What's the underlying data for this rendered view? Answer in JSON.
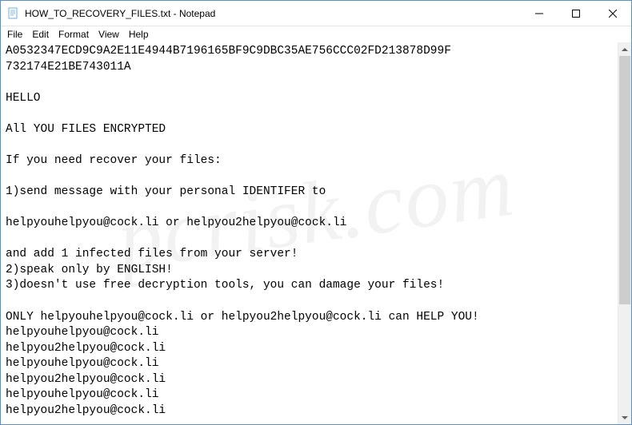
{
  "titlebar": {
    "title": "HOW_TO_RECOVERY_FILES.txt - Notepad"
  },
  "menubar": {
    "items": [
      "File",
      "Edit",
      "Format",
      "View",
      "Help"
    ]
  },
  "content": {
    "lines": [
      "A0532347ECD9C9A2E11E4944B7196165BF9C9DBC35AE756CCC02FD213878D99F",
      "732174E21BE743011A",
      "",
      "HELLO",
      "",
      "All YOU FILES ENCRYPTED",
      "",
      "If you need recover your files:",
      "",
      "1)send message with your personal IDENTIFER to",
      "",
      "helpyouhelpyou@cock.li or helpyou2helpyou@cock.li",
      "",
      "and add 1 infected files from your server!",
      "2)speak only by ENGLISH!",
      "3)doesn't use free decryption tools, you can damage your files!",
      "",
      "ONLY helpyouhelpyou@cock.li or helpyou2helpyou@cock.li can HELP YOU!",
      "helpyouhelpyou@cock.li",
      "helpyou2helpyou@cock.li",
      "helpyouhelpyou@cock.li",
      "helpyou2helpyou@cock.li",
      "helpyouhelpyou@cock.li",
      "helpyou2helpyou@cock.li"
    ]
  },
  "watermark": "pcrisk.com"
}
